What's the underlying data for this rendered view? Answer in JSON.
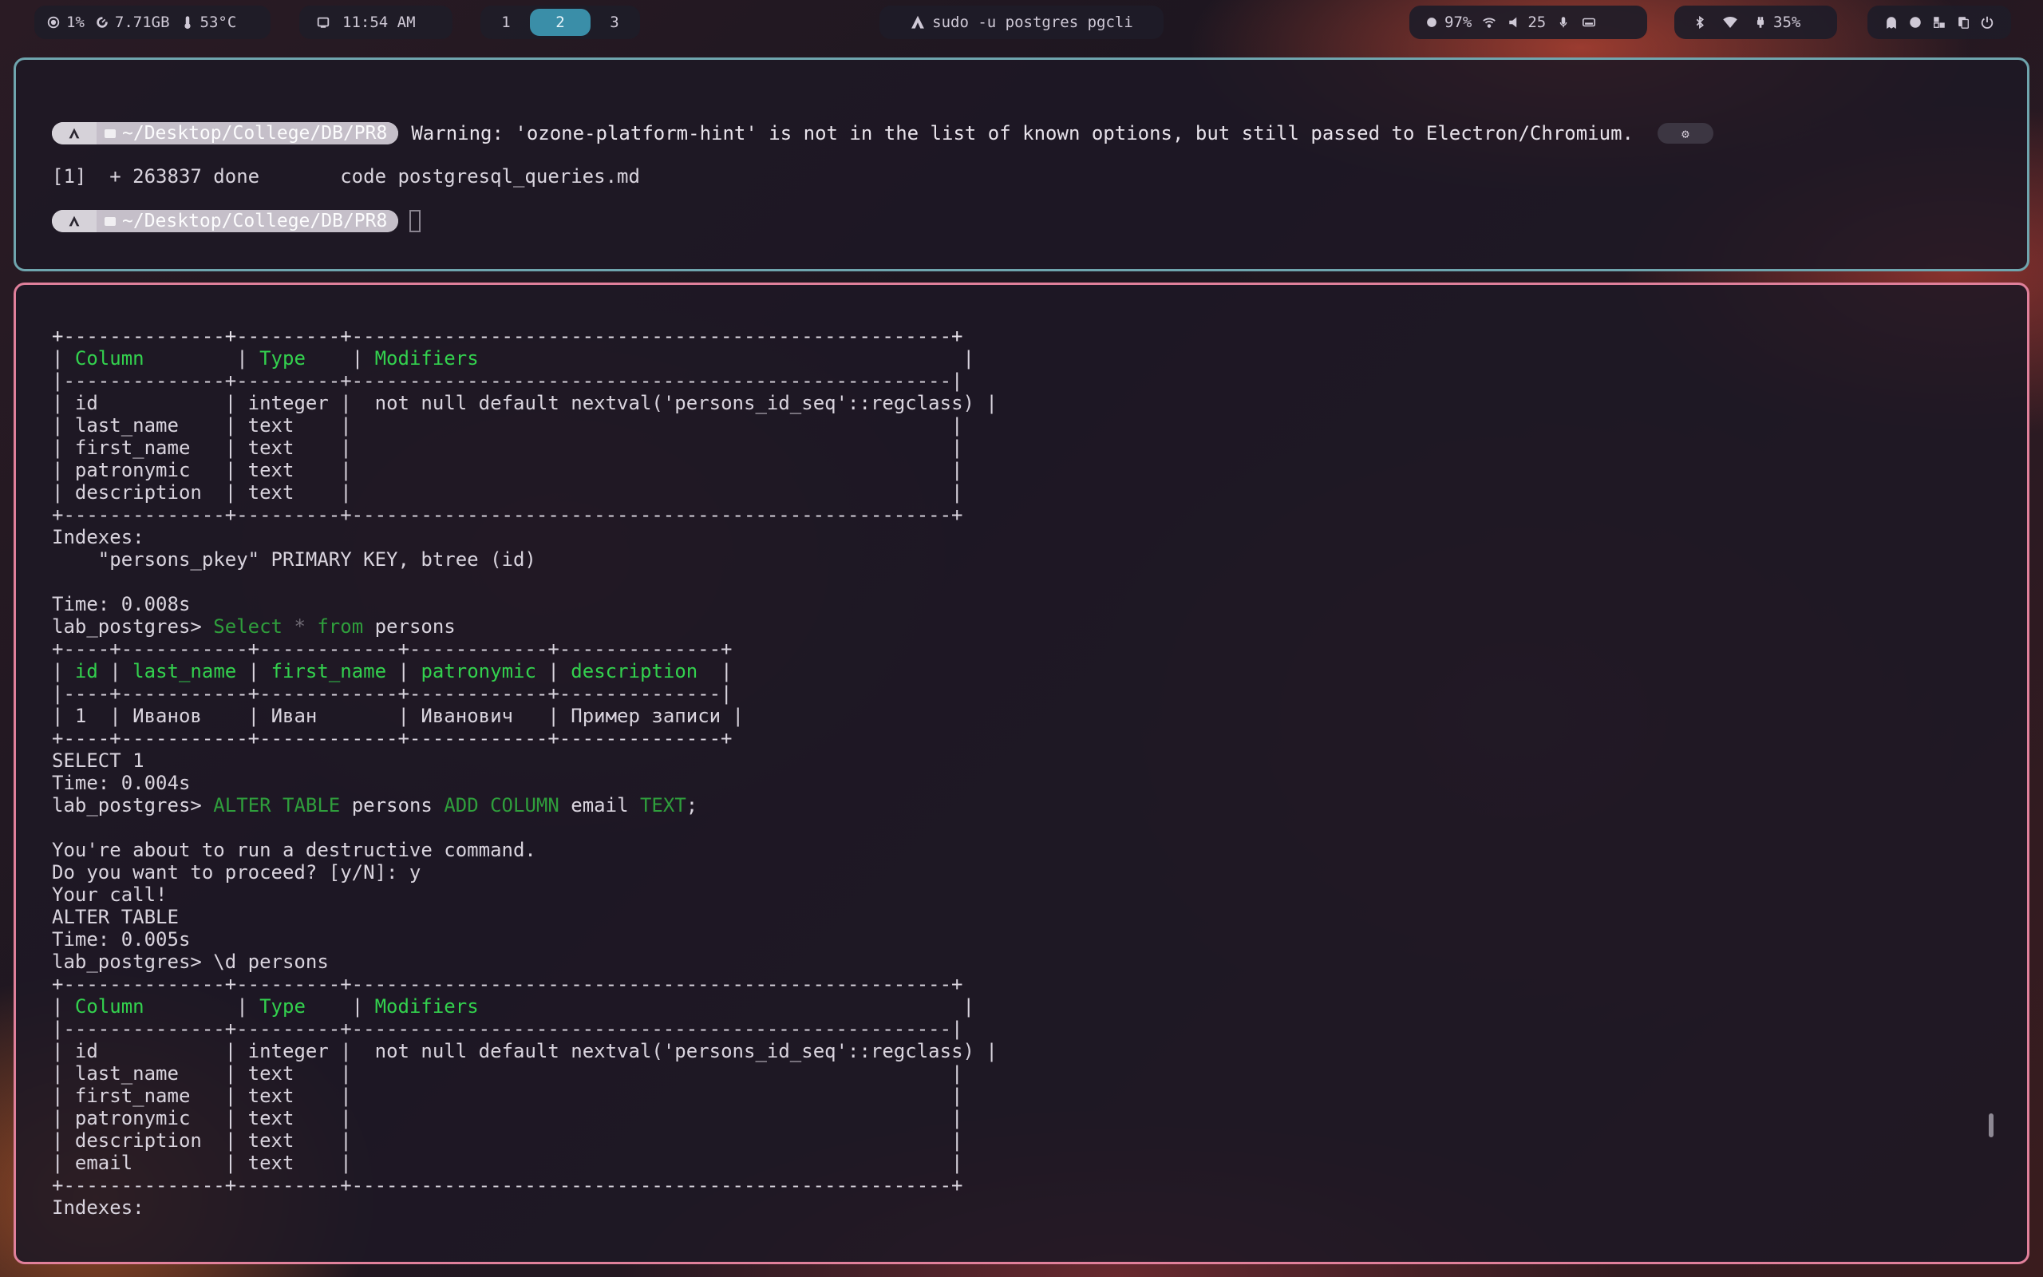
{
  "topbar": {
    "cpu": "1%",
    "memory": "7.71GB",
    "temperature": "53°C",
    "clock": "11:54 AM",
    "workspaces": [
      "1",
      "2",
      "3"
    ],
    "active_workspace": "2",
    "window_title": "sudo -u postgres pgcli",
    "brightness": "97%",
    "volume": "25",
    "battery": "35%"
  },
  "term_top": {
    "prompt_path": "~/Desktop/College/DB/PR8",
    "warning": "Warning: 'ozone-platform-hint' is not in the list of known options, but still passed to Electron/Chromium.",
    "job_line": "[1]  + 263837 done       code postgresql_queries.md"
  },
  "table_border": {
    "top": "+--------------+---------+----------------------------------------------------+",
    "mid": "|--------------+---------+----------------------------------------------------|",
    "bot": "+--------------+---------+----------------------------------------------------+"
  },
  "desc_table": {
    "headers": [
      "Column",
      "Type",
      "Modifiers"
    ],
    "rows": [
      [
        "id",
        "integer",
        " not null default nextval('persons_id_seq'::regclass)"
      ],
      [
        "last_name",
        "text",
        ""
      ],
      [
        "first_name",
        "text",
        ""
      ],
      [
        "patronymic",
        "text",
        ""
      ],
      [
        "description",
        "text",
        ""
      ]
    ]
  },
  "after_desc": {
    "indexes_label": "Indexes:",
    "index_line": "    \"persons_pkey\" PRIMARY KEY, btree (id)",
    "time1": "Time: 0.008s"
  },
  "select_cmd": {
    "prompt": "lab_postgres> ",
    "kw1": "Select",
    "star": "*",
    "kw2": "from",
    "table": "persons"
  },
  "select_table": {
    "top": "+----+-----------+------------+------------+--------------+",
    "mid": "|----+-----------+------------+------------+--------------|",
    "bot": "+----+-----------+------------+------------+--------------+",
    "headers": [
      "id",
      "last_name",
      "first_name",
      "patronymic",
      "description"
    ],
    "row": [
      "1",
      "Иванов",
      "Иван",
      "Иванович",
      "Пример записи"
    ]
  },
  "after_select": {
    "select_count": "SELECT 1",
    "time2": "Time: 0.004s"
  },
  "alter_cmd": {
    "prompt": "lab_postgres> ",
    "kw1": "ALTER TABLE",
    "table": "persons",
    "kw2": "ADD COLUMN",
    "column": "email",
    "kw3": "TEXT",
    "semi": ";"
  },
  "alter_out": {
    "warn1": "You're about to run a destructive command.",
    "warn2": "Do you want to proceed? [y/N]: y",
    "warn3": "Your call!",
    "result": "ALTER TABLE",
    "time3": "Time: 0.005s"
  },
  "d_cmd": {
    "text": "lab_postgres> \\d persons"
  },
  "desc_table2": {
    "rows": [
      [
        "id",
        "integer",
        " not null default nextval('persons_id_seq'::regclass)"
      ],
      [
        "last_name",
        "text",
        ""
      ],
      [
        "first_name",
        "text",
        ""
      ],
      [
        "patronymic",
        "text",
        ""
      ],
      [
        "description",
        "text",
        ""
      ],
      [
        "email",
        "text",
        ""
      ]
    ],
    "indexes_label": "Indexes:"
  }
}
